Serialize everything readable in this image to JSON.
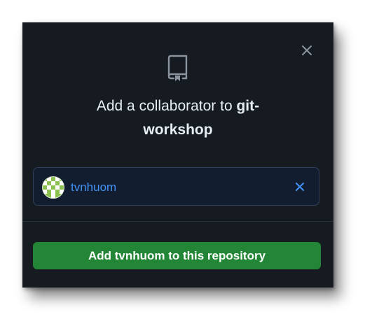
{
  "dialog": {
    "title_prefix": "Add a collaborator to ",
    "title_repo_part1": "git-",
    "title_repo_part2": "workshop",
    "close_icon": "close-icon",
    "repo_icon": "repo-icon"
  },
  "selected_user": {
    "username": "tvnhuom",
    "remove_icon": "close-icon",
    "avatar_colors": [
      "#8cc152",
      "#ffffff"
    ]
  },
  "actions": {
    "add_button_label": "Add tvnhuom to this repository"
  },
  "colors": {
    "background": "#161b22",
    "accent_blue": "#4493f8",
    "primary_green": "#238636",
    "text": "#e6edf3",
    "muted_icon": "#8b949e"
  }
}
